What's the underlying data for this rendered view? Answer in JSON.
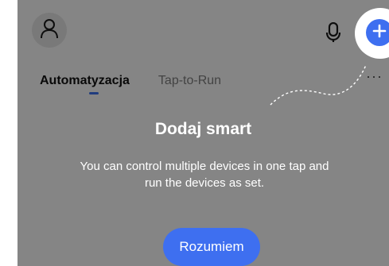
{
  "header": {
    "avatar_icon": "user-icon",
    "mic_icon": "microphone-icon",
    "add_icon": "plus-icon"
  },
  "tabs": [
    {
      "label": "Automatyzacja",
      "active": true
    },
    {
      "label": "Tap-to-Run",
      "active": false
    }
  ],
  "more_menu": {
    "label": "···",
    "icon": "more-dots-icon"
  },
  "coach": {
    "title": "Dodaj smart",
    "description": "You can control multiple devices in one tap and run the devices as set.",
    "button_label": "Rozumiem"
  },
  "colors": {
    "accent": "#3e6ff0",
    "overlay": "rgba(0,0,0,0.45)",
    "background": "#f2f2f2"
  }
}
